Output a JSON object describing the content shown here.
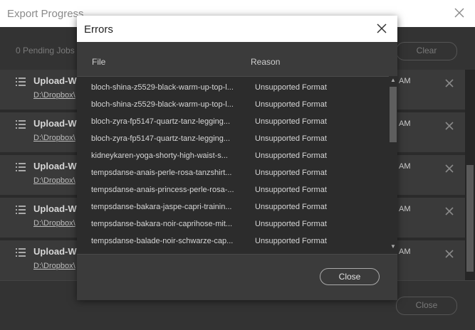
{
  "background": {
    "title": "Export Progress",
    "pending_label": "0 Pending Jobs",
    "clear_label": "Clear",
    "close_label": "Close",
    "jobs": [
      {
        "title": "Upload-WI",
        "path": "D:\\Dropbox\\",
        "time": "AM"
      },
      {
        "title": "Upload-WI",
        "path": "D:\\Dropbox\\",
        "time": "AM"
      },
      {
        "title": "Upload-WI",
        "path": "D:\\Dropbox\\",
        "time": "AM"
      },
      {
        "title": "Upload-WI",
        "path": "D:\\Dropbox\\",
        "time": "AM"
      },
      {
        "title": "Upload-WI",
        "path": "D:\\Dropbox\\",
        "time": "AM"
      }
    ]
  },
  "modal": {
    "title": "Errors",
    "columns": {
      "file": "File",
      "reason": "Reason"
    },
    "rows": [
      {
        "file": "bloch-shina-z5529-black-warm-up-top-l...",
        "reason": "Unsupported Format"
      },
      {
        "file": "bloch-shina-z5529-black-warm-up-top-l...",
        "reason": "Unsupported Format"
      },
      {
        "file": "bloch-zyra-fp5147-quartz-tanz-legging...",
        "reason": "Unsupported Format"
      },
      {
        "file": "bloch-zyra-fp5147-quartz-tanz-legging...",
        "reason": "Unsupported Format"
      },
      {
        "file": "kidneykaren-yoga-shorty-high-waist-s...",
        "reason": "Unsupported Format"
      },
      {
        "file": "tempsdanse-anais-perle-rosa-tanzshirt...",
        "reason": "Unsupported Format"
      },
      {
        "file": "tempsdanse-anais-princess-perle-rosa-...",
        "reason": "Unsupported Format"
      },
      {
        "file": "tempsdanse-bakara-jaspe-capri-trainin...",
        "reason": "Unsupported Format"
      },
      {
        "file": "tempsdanse-bakara-noir-caprihose-mit...",
        "reason": "Unsupported Format"
      },
      {
        "file": "tempsdanse-balade-noir-schwarze-cap...",
        "reason": "Unsupported Format"
      }
    ],
    "close_label": "Close"
  },
  "icons": {
    "window_close": "close-icon",
    "list": "list-icon",
    "remove": "x-icon",
    "scroll_up": "chevron-up-icon",
    "scroll_down": "chevron-down-icon"
  }
}
